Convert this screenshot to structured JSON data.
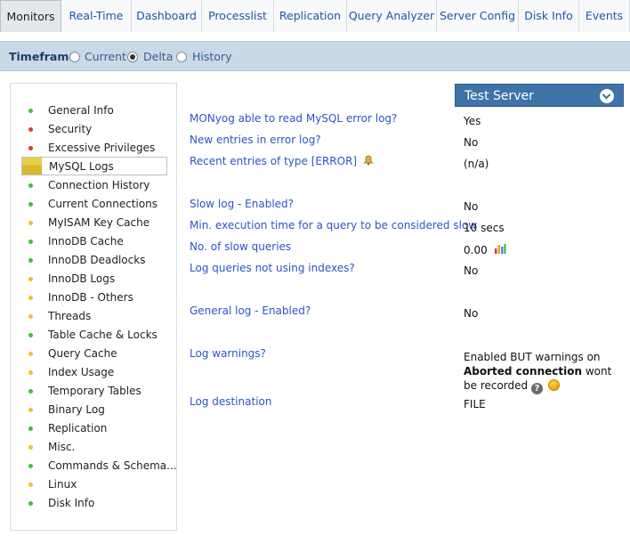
{
  "tabs": [
    "Monitors",
    "Real-Time",
    "Dashboard",
    "Processlist",
    "Replication",
    "Query Analyzer",
    "Server Config",
    "Disk Info",
    "Events"
  ],
  "timeframe": {
    "label": "Timeframe",
    "options": [
      "Current",
      "Delta",
      "History"
    ],
    "selected": "Delta"
  },
  "sidebar": {
    "items": [
      {
        "label": "General Info",
        "status": "green"
      },
      {
        "label": "Security",
        "status": "red"
      },
      {
        "label": "Excessive Privileges",
        "status": "red"
      },
      {
        "label": "MySQL Logs",
        "status": "yellow",
        "selected": true
      },
      {
        "label": "Connection History",
        "status": "green"
      },
      {
        "label": "Current Connections",
        "status": "green"
      },
      {
        "label": "MyISAM Key Cache",
        "status": "yellow"
      },
      {
        "label": "InnoDB Cache",
        "status": "green"
      },
      {
        "label": "InnoDB Deadlocks",
        "status": "green"
      },
      {
        "label": "InnoDB Logs",
        "status": "yellow"
      },
      {
        "label": "InnoDB - Others",
        "status": "yellow"
      },
      {
        "label": "Threads",
        "status": "yellow"
      },
      {
        "label": "Table Cache & Locks",
        "status": "green"
      },
      {
        "label": "Query Cache",
        "status": "yellow"
      },
      {
        "label": "Index Usage",
        "status": "yellow"
      },
      {
        "label": "Temporary Tables",
        "status": "green"
      },
      {
        "label": "Binary Log",
        "status": "yellow"
      },
      {
        "label": "Replication",
        "status": "green"
      },
      {
        "label": "Misc.",
        "status": "yellow"
      },
      {
        "label": "Commands & Schema...",
        "status": "green"
      },
      {
        "label": "Linux",
        "status": "yellow"
      },
      {
        "label": "Disk Info",
        "status": "green"
      }
    ]
  },
  "status_colors": {
    "green": "#3fbf3f",
    "red": "#e0383a",
    "yellow": "#e9c42f"
  },
  "server": {
    "name": "Test Server"
  },
  "rows": [
    {
      "question": "MONyog able to read MySQL error log?",
      "value": "Yes"
    },
    {
      "question": "New entries in error log?",
      "value": "No"
    },
    {
      "question": "Recent entries of type [ERROR]",
      "value": "(n/a)",
      "icon": "bell-icon"
    },
    {
      "question": "Slow log - Enabled?",
      "value": "No"
    },
    {
      "question": "Min. execution time for a query to be considered slow",
      "value": "10 secs"
    },
    {
      "question": "No. of slow queries",
      "value": "0.00",
      "icon": "bar-chart-icon"
    },
    {
      "question": "Log queries not using indexes?",
      "value": "No"
    },
    {
      "question": "General log - Enabled?",
      "value": "No"
    },
    {
      "question": "Log warnings?",
      "value_pre": "Enabled BUT warnings on",
      "value_bold": "Aborted connection",
      "value_post": "wont be recorded"
    },
    {
      "question": "Log destination",
      "value": "FILE"
    }
  ],
  "help_glyph": "?"
}
